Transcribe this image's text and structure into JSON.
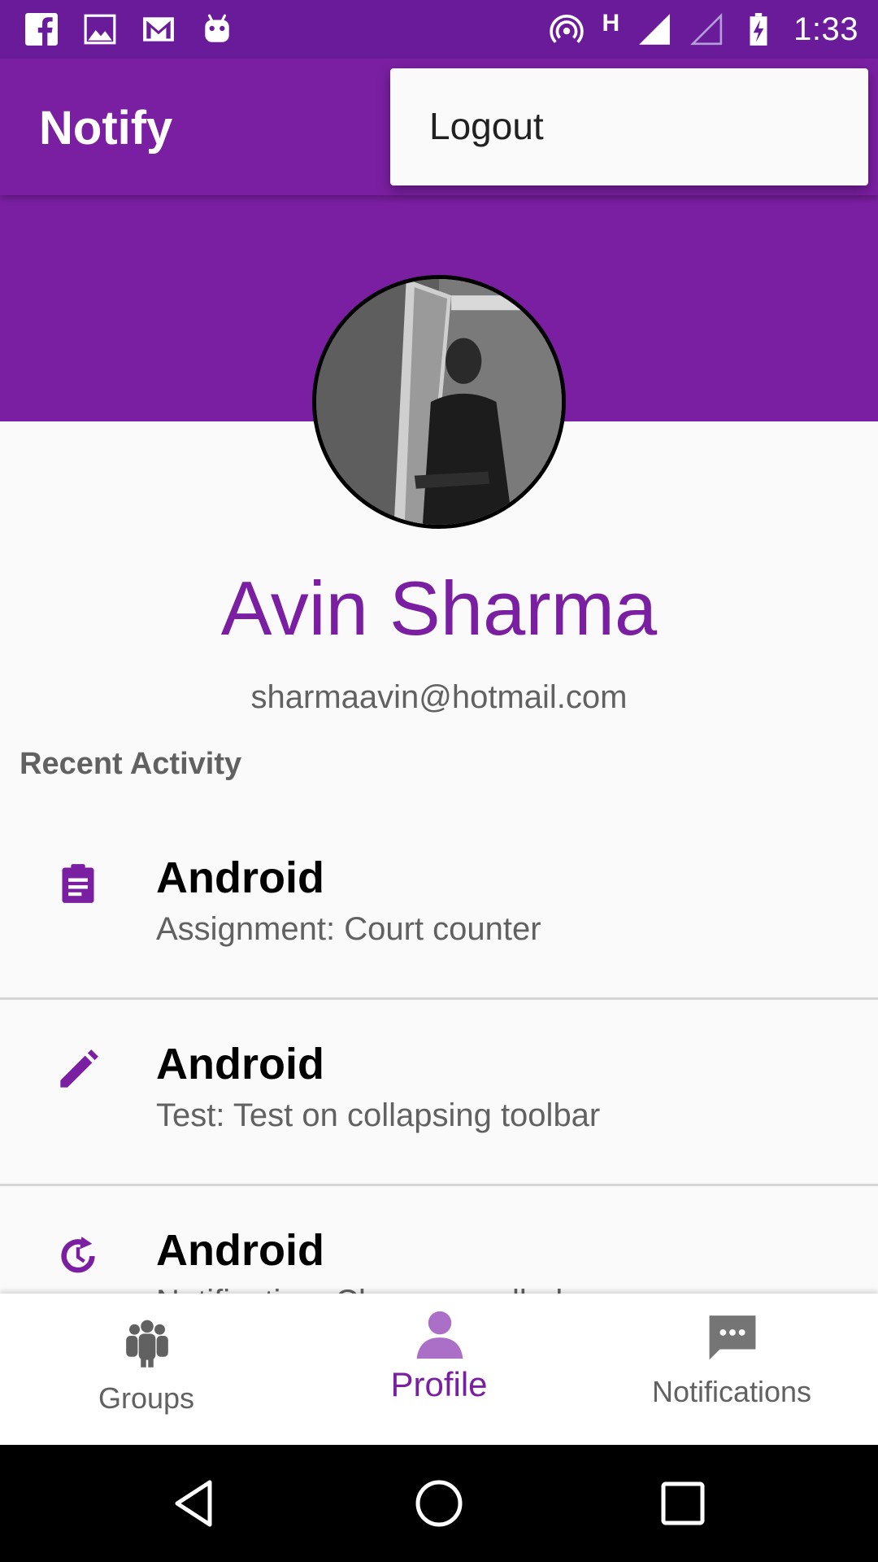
{
  "status_bar": {
    "time": "1:33",
    "network_type": "H",
    "left_icons": [
      "facebook-icon",
      "image-icon",
      "gmail-icon",
      "android-debug-icon"
    ],
    "right_icons": [
      "hotspot-icon",
      "signal-icon",
      "signal-empty-icon",
      "battery-charging-icon"
    ]
  },
  "toolbar": {
    "title": "Notify"
  },
  "overflow_menu": {
    "items": [
      {
        "label": "Logout"
      }
    ]
  },
  "profile": {
    "name": "Avin Sharma",
    "email": "sharmaavin@hotmail.com",
    "avatar": "profile-photo"
  },
  "recent_activity": {
    "heading": "Recent Activity",
    "items": [
      {
        "icon": "assignment-icon",
        "title": "Android",
        "subtitle": "Assignment: Court counter"
      },
      {
        "icon": "pencil-icon",
        "title": "Android",
        "subtitle": "Test: Test on collapsing toolbar"
      },
      {
        "icon": "reschedule-icon",
        "title": "Android",
        "subtitle": "Notification: Class cancelled"
      }
    ]
  },
  "bottom_nav": {
    "items": [
      {
        "label": "Groups",
        "icon": "groups-icon",
        "selected": false
      },
      {
        "label": "Profile",
        "icon": "person-icon",
        "selected": true
      },
      {
        "label": "Notifications",
        "icon": "chat-icon",
        "selected": false
      }
    ]
  },
  "colors": {
    "status_bar": "#6A1B9A",
    "primary": "#7B1FA2",
    "nav_selected": "#7B1FA2",
    "nav_unselected": "#616161"
  }
}
